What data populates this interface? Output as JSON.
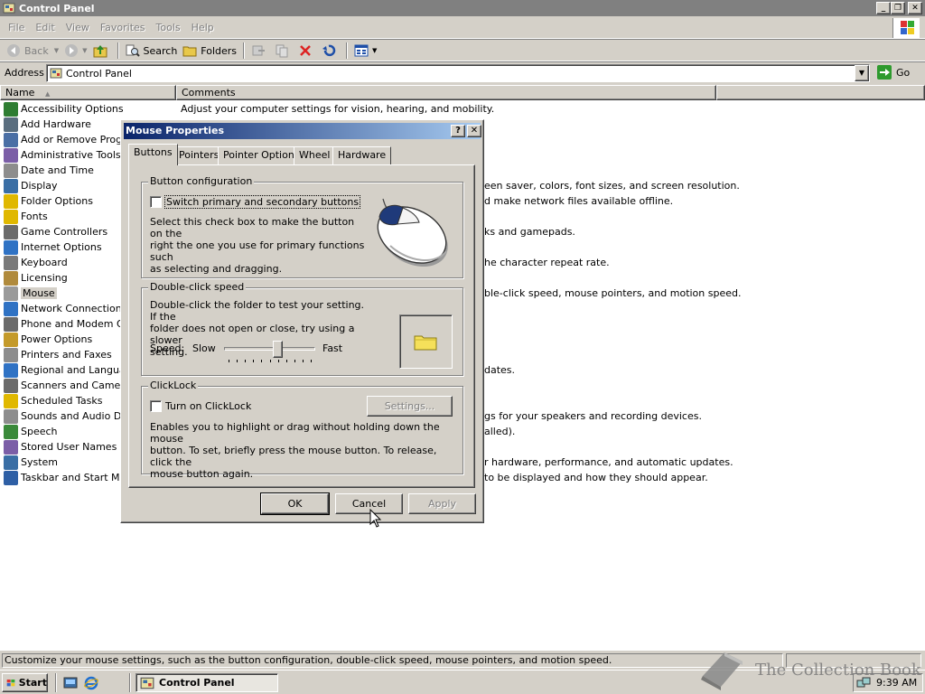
{
  "window": {
    "title": "Control Panel"
  },
  "menu": [
    "File",
    "Edit",
    "View",
    "Favorites",
    "Tools",
    "Help"
  ],
  "toolbar": {
    "back": "Back",
    "search": "Search",
    "folders": "Folders"
  },
  "address": {
    "label": "Address",
    "value": "Control Panel",
    "go": "Go"
  },
  "columns": {
    "name": "Name",
    "comments": "Comments"
  },
  "items": [
    {
      "name": "Accessibility Options",
      "comment": "Adjust your computer settings for vision, hearing, and mobility.",
      "color": "#2e7d32"
    },
    {
      "name": "Add Hardware",
      "comment": "",
      "color": "#5a6e7f"
    },
    {
      "name": "Add or Remove Progra",
      "comment": "",
      "color": "#4a6fa5"
    },
    {
      "name": "Administrative Tools",
      "comment": "",
      "color": "#7b5ea7"
    },
    {
      "name": "Date and Time",
      "comment": "",
      "color": "#8d8d8d"
    },
    {
      "name": "Display",
      "comment": "een saver, colors, font sizes, and screen resolution.",
      "color": "#3a6ea5"
    },
    {
      "name": "Folder Options",
      "comment": "d make network files available offline.",
      "color": "#e0b800"
    },
    {
      "name": "Fonts",
      "comment": "",
      "color": "#e0b800"
    },
    {
      "name": "Game Controllers",
      "comment": "ks and gamepads.",
      "color": "#6b6b6b"
    },
    {
      "name": "Internet Options",
      "comment": "",
      "color": "#2f72c4"
    },
    {
      "name": "Keyboard",
      "comment": "he character repeat rate.",
      "color": "#7a7a7a"
    },
    {
      "name": "Licensing",
      "comment": "",
      "color": "#b08a3c"
    },
    {
      "name": "Mouse",
      "comment": "ble-click speed, mouse pointers, and motion speed.",
      "color": "#9a9a9a"
    },
    {
      "name": "Network Connections",
      "comment": "",
      "color": "#2f72c4"
    },
    {
      "name": "Phone and Modem Opt",
      "comment": "",
      "color": "#6b6b6b"
    },
    {
      "name": "Power Options",
      "comment": "",
      "color": "#c49a2a"
    },
    {
      "name": "Printers and Faxes",
      "comment": "",
      "color": "#8d8d8d"
    },
    {
      "name": "Regional and Language",
      "comment": "dates.",
      "color": "#2f72c4"
    },
    {
      "name": "Scanners and Cameras",
      "comment": "",
      "color": "#6b6b6b"
    },
    {
      "name": "Scheduled Tasks",
      "comment": "",
      "color": "#e0b800"
    },
    {
      "name": "Sounds and Audio Dev",
      "comment": "gs for your speakers and recording devices.",
      "color": "#8d8d8d"
    },
    {
      "name": "Speech",
      "comment": "alled).",
      "color": "#3a8a3a"
    },
    {
      "name": "Stored User Names and",
      "comment": "",
      "color": "#7b5ea7"
    },
    {
      "name": "System",
      "comment": "r hardware, performance, and automatic updates.",
      "color": "#3a6ea5"
    },
    {
      "name": "Taskbar and Start Men",
      "comment": "to be displayed and how they should appear.",
      "color": "#2e5fa5"
    }
  ],
  "selected_item": "Mouse",
  "dialog": {
    "title": "Mouse Properties",
    "tabs": [
      "Buttons",
      "Pointers",
      "Pointer Options",
      "Wheel",
      "Hardware"
    ],
    "active_tab": "Buttons",
    "button_config": {
      "title": "Button configuration",
      "checkbox_label": "Switch primary and secondary buttons",
      "checked": false,
      "desc_lines": [
        "Select this check box to make the button on the",
        "right the one you use for primary functions such",
        "as selecting and dragging."
      ]
    },
    "double_click": {
      "title": "Double-click speed",
      "desc_lines": [
        "Double-click the folder to test your setting. If the",
        "folder does not open or close, try using a slower",
        "setting."
      ],
      "speed_label": "Speed:",
      "slow": "Slow",
      "fast": "Fast",
      "speed_value": 0.6
    },
    "clicklock": {
      "title": "ClickLock",
      "checkbox_label": "Turn on ClickLock",
      "checked": false,
      "settings_button": "Settings...",
      "desc_lines": [
        "Enables you to highlight or drag without holding down the mouse",
        "button. To set, briefly press the mouse button. To release, click the",
        "mouse button again."
      ]
    },
    "buttons": {
      "ok": "OK",
      "cancel": "Cancel",
      "apply": "Apply"
    }
  },
  "status": {
    "text": "Customize your mouse settings, such as the button configuration, double-click speed, mouse pointers, and motion speed."
  },
  "taskbar": {
    "start": "Start",
    "task": "Control Panel",
    "time": "9:39 AM"
  },
  "watermark": "The Collection Book"
}
